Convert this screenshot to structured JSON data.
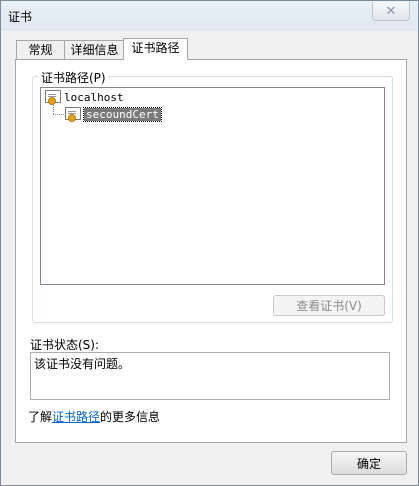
{
  "window": {
    "title": "证书",
    "close_symbol": "✕"
  },
  "tabs": [
    {
      "label": "常规",
      "active": false
    },
    {
      "label": "详细信息",
      "active": false
    },
    {
      "label": "证书路径",
      "active": true
    }
  ],
  "cert_path": {
    "group_label": "证书路径(P)",
    "nodes": [
      {
        "label": "localhost",
        "icon": "certificate-icon",
        "selected": false
      },
      {
        "label": "secoundCert",
        "icon": "certificate-icon",
        "selected": true
      }
    ],
    "view_cert_button": "查看证书(V)"
  },
  "status": {
    "label": "证书状态(S):",
    "text": "该证书没有问题。"
  },
  "learn_more": {
    "prefix": "了解",
    "link_text": "证书路径",
    "suffix": "的更多信息"
  },
  "footer": {
    "ok_button": "确定"
  }
}
